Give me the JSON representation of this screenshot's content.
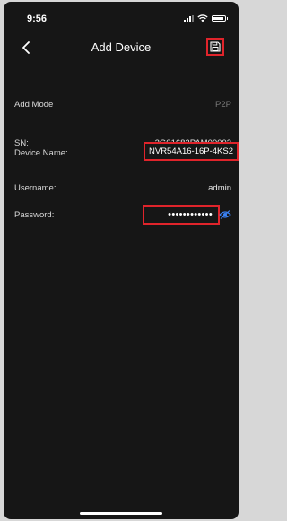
{
  "status_bar": {
    "time": "9:56"
  },
  "header": {
    "title": "Add Device"
  },
  "fields": {
    "add_mode": {
      "label": "Add Mode",
      "value": "P2P"
    },
    "sn": {
      "label": "SN:",
      "value": "2G01682PAM00003"
    },
    "device_name": {
      "label": "Device Name:",
      "value": "NVR54A16-16P-4KS2"
    },
    "username": {
      "label": "Username:",
      "value": "admin"
    },
    "password": {
      "label": "Password:",
      "value": "••••••••••••"
    }
  },
  "icons": {
    "back": "chevron-left-icon",
    "save": "save-icon",
    "show_password": "eye-icon"
  },
  "colors": {
    "background": "#161616",
    "highlight": "#e0242b",
    "accent": "#3b82f6",
    "dim_text": "#7a7a7a"
  }
}
